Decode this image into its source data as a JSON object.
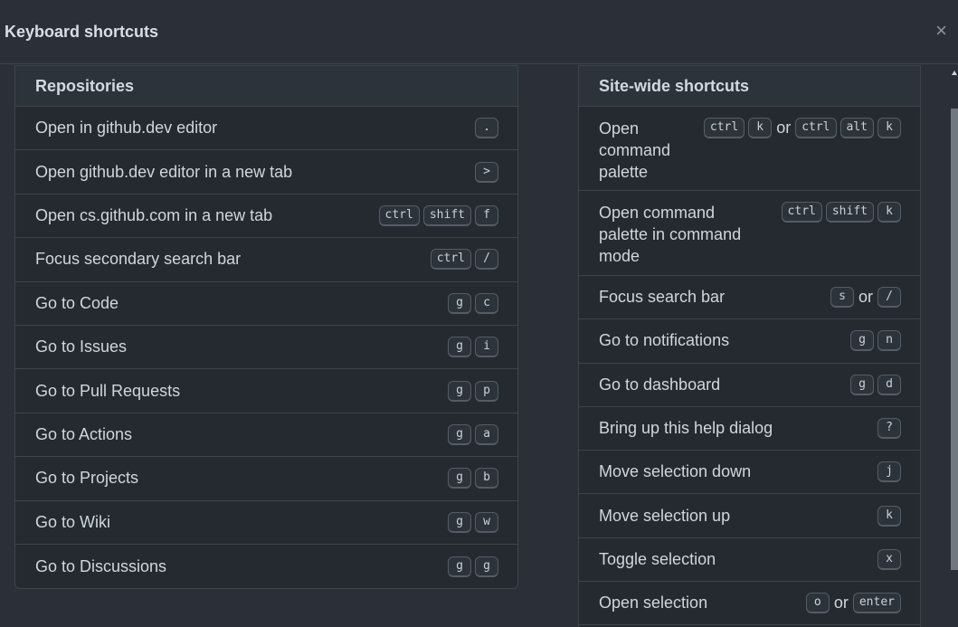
{
  "dialog": {
    "title": "Keyboard shortcuts",
    "close_icon": "×"
  },
  "repositories": {
    "heading": "Repositories",
    "rows": [
      {
        "label": "Open in github.dev editor",
        "keys": [
          "."
        ]
      },
      {
        "label": "Open github.dev editor in a new tab",
        "keys": [
          ">"
        ]
      },
      {
        "label": "Open cs.github.com in a new tab",
        "keys": [
          "ctrl",
          "shift",
          "f"
        ]
      },
      {
        "label": "Focus secondary search bar",
        "keys": [
          "ctrl",
          "/"
        ]
      },
      {
        "label": "Go to Code",
        "keys": [
          "g",
          "c"
        ]
      },
      {
        "label": "Go to Issues",
        "keys": [
          "g",
          "i"
        ]
      },
      {
        "label": "Go to Pull Requests",
        "keys": [
          "g",
          "p"
        ]
      },
      {
        "label": "Go to Actions",
        "keys": [
          "g",
          "a"
        ]
      },
      {
        "label": "Go to Projects",
        "keys": [
          "g",
          "b"
        ]
      },
      {
        "label": "Go to Wiki",
        "keys": [
          "g",
          "w"
        ]
      },
      {
        "label": "Go to Discussions",
        "keys": [
          "g",
          "g"
        ]
      }
    ]
  },
  "site_wide": {
    "heading": "Site-wide shortcuts",
    "or": "or",
    "rows": [
      {
        "label": "Open command palette",
        "keys": [
          "ctrl",
          "k"
        ],
        "alt_keys": [
          "ctrl",
          "alt",
          "k"
        ]
      },
      {
        "label": "Open command palette in command mode",
        "keys": [
          "ctrl",
          "shift",
          "k"
        ]
      },
      {
        "label": "Focus search bar",
        "keys": [
          "s"
        ],
        "alt_keys": [
          "/"
        ]
      },
      {
        "label": "Go to notifications",
        "keys": [
          "g",
          "n"
        ]
      },
      {
        "label": "Go to dashboard",
        "keys": [
          "g",
          "d"
        ]
      },
      {
        "label": "Bring up this help dialog",
        "keys": [
          "?"
        ]
      },
      {
        "label": "Move selection down",
        "keys": [
          "j"
        ]
      },
      {
        "label": "Move selection up",
        "keys": [
          "k"
        ]
      },
      {
        "label": "Toggle selection",
        "keys": [
          "x"
        ]
      },
      {
        "label": "Open selection",
        "keys": [
          "o"
        ],
        "alt_keys": [
          "enter"
        ]
      }
    ]
  }
}
